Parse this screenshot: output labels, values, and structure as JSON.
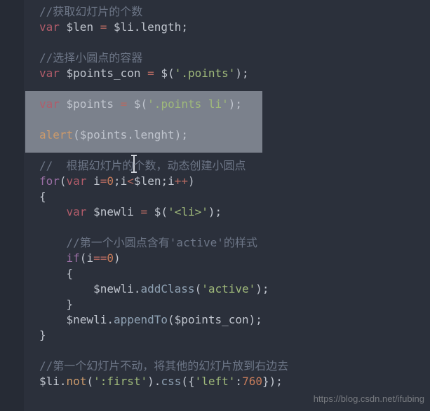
{
  "watermark": "https://blog.csdn.net/ifubing",
  "code": {
    "l01_comment": "//获取幻灯片的个数",
    "l02_var": "var",
    "l02_lhs": " $len ",
    "l02_eq": "=",
    "l02_rhs": " $li",
    "l02_dot": ".",
    "l02_prop": "length",
    "l02_semi": ";",
    "l04_comment": "//选择小圆点的容器",
    "l05_var": "var",
    "l05_lhs": " $points_con ",
    "l05_eq": "=",
    "l05_sp": " ",
    "l05_jq": "$",
    "l05_p1": "(",
    "l05_str": "'.points'",
    "l05_p2": ")",
    "l05_semi": ";",
    "l07_var": "var",
    "l07_lhs": " $points ",
    "l07_eq": "=",
    "l07_sp": " ",
    "l07_jq": "$",
    "l07_p1": "(",
    "l07_str": "'.points li'",
    "l07_p2": ")",
    "l07_semi": ";",
    "l09_fn": "alert",
    "l09_p1": "(",
    "l09_arg1": "$points",
    "l09_dot": ".",
    "l09_arg2": "lenght",
    "l09_p2": ")",
    "l09_semi": ";",
    "l11_comment_a": "//  根据幻灯片",
    "l11_comment_b": "的个数，动态创建小圆点",
    "l12_for": "for",
    "l12_p1": "(",
    "l12_var": "var",
    "l12_sp": " i",
    "l12_eq": "=",
    "l12_zero": "0",
    "l12_semi1": ";",
    "l12_cond_l": "i",
    "l12_lt": "<",
    "l12_cond_r": "$len",
    "l12_semi2": ";",
    "l12_inc_l": "i",
    "l12_inc": "++",
    "l12_p2": ")",
    "l13_brL": "{",
    "l14_var": "var",
    "l14_lhs": " $newli ",
    "l14_eq": "=",
    "l14_sp": " ",
    "l14_jq": "$",
    "l14_p1": "(",
    "l14_str": "'<li>'",
    "l14_p2": ")",
    "l14_semi": ";",
    "l16_comment": "//第一个小圆点含有'active'的样式",
    "l17_if": "if",
    "l17_p1": "(",
    "l17_cond_l": "i",
    "l17_eqeq": "==",
    "l17_cond_r": "0",
    "l17_p2": ")",
    "l18_brL": "{",
    "l19_obj": "$newli",
    "l19_dot": ".",
    "l19_method": "addClass",
    "l19_p1": "(",
    "l19_str": "'active'",
    "l19_p2": ")",
    "l19_semi": ";",
    "l20_brR": "}",
    "l21_obj": "$newli",
    "l21_dot": ".",
    "l21_method": "appendTo",
    "l21_p1": "(",
    "l21_arg": "$points_con",
    "l21_p2": ")",
    "l21_semi": ";",
    "l22_brR": "}",
    "l24_comment": "//第一个幻灯片不动，将其他的幻灯片放到右边去",
    "l25_obj": "$li",
    "l25_dot1": ".",
    "l25_fn1": "not",
    "l25_p1": "(",
    "l25_str1": "':first'",
    "l25_p2": ")",
    "l25_dot2": ".",
    "l25_fn2": "css",
    "l25_p3": "(",
    "l25_brL": "{",
    "l25_str2": "'left'",
    "l25_colon": ":",
    "l25_num": "760",
    "l25_brR": "}",
    "l25_p4": ")",
    "l25_semi": ";"
  }
}
